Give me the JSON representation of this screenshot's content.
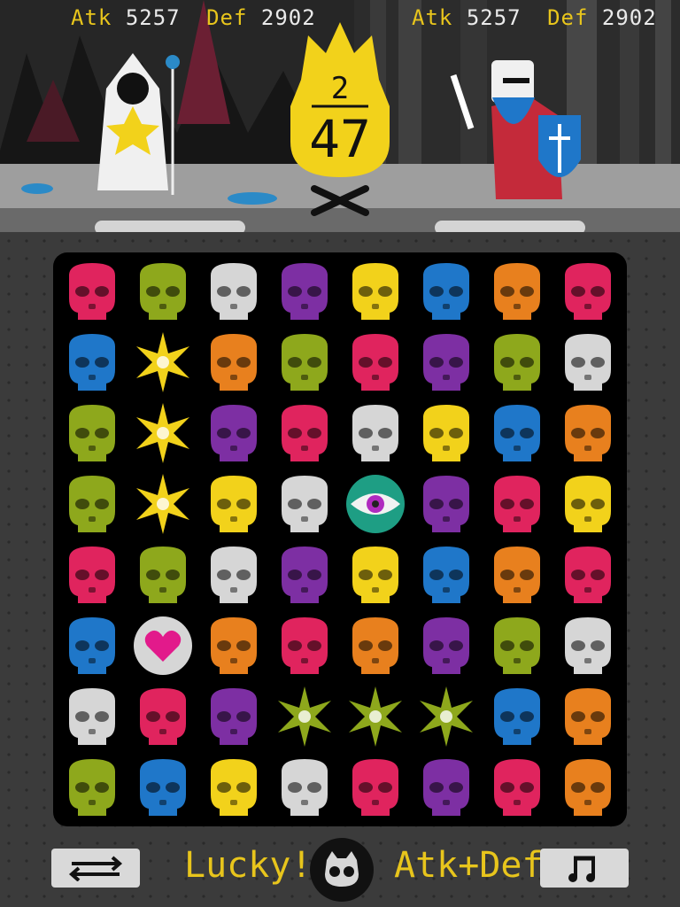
{
  "left_stats": {
    "atk_label": "Atk",
    "atk_value": "5257",
    "def_label": "Def",
    "def_value": "2902"
  },
  "right_stats": {
    "atk_label": "Atk",
    "atk_value": "5257",
    "def_label": "Def",
    "def_value": "2902"
  },
  "turn_counter": {
    "current": "2",
    "total": "47"
  },
  "bottom_bar": {
    "swap_icon": "swap-arrows-icon",
    "status_text": "Lucky!",
    "center_icon": "skull-menu-icon",
    "mode_text": "Atk+Def",
    "music_icon": "music-note-icon"
  },
  "colors": {
    "red": "#e0245e",
    "green": "#8ea81c",
    "white": "#d6d6d6",
    "purple": "#7d2fa3",
    "yellow": "#f2d21b",
    "blue": "#1f77c9",
    "orange": "#e8801e",
    "accent": "#e8c51c"
  },
  "board": {
    "columns": 8,
    "rows": [
      [
        "red",
        "green",
        "white",
        "purple",
        "yellow",
        "blue",
        "orange",
        "red"
      ],
      [
        "blue",
        "star-yellow",
        "orange",
        "green",
        "red",
        "purple",
        "green",
        "white"
      ],
      [
        "green",
        "star-yellow",
        "purple",
        "red",
        "white",
        "yellow",
        "blue",
        "orange"
      ],
      [
        "green",
        "star-yellow",
        "yellow",
        "white",
        "eye",
        "purple",
        "red",
        "yellow"
      ],
      [
        "red",
        "green",
        "white",
        "purple",
        "yellow",
        "blue",
        "orange",
        "red"
      ],
      [
        "blue",
        "heart",
        "orange",
        "red",
        "orange",
        "purple",
        "green",
        "white"
      ],
      [
        "white",
        "red",
        "purple",
        "star-green",
        "star-green",
        "star-green",
        "blue",
        "orange"
      ],
      [
        "green",
        "blue",
        "yellow",
        "white",
        "red",
        "purple",
        "red",
        "orange"
      ]
    ]
  }
}
